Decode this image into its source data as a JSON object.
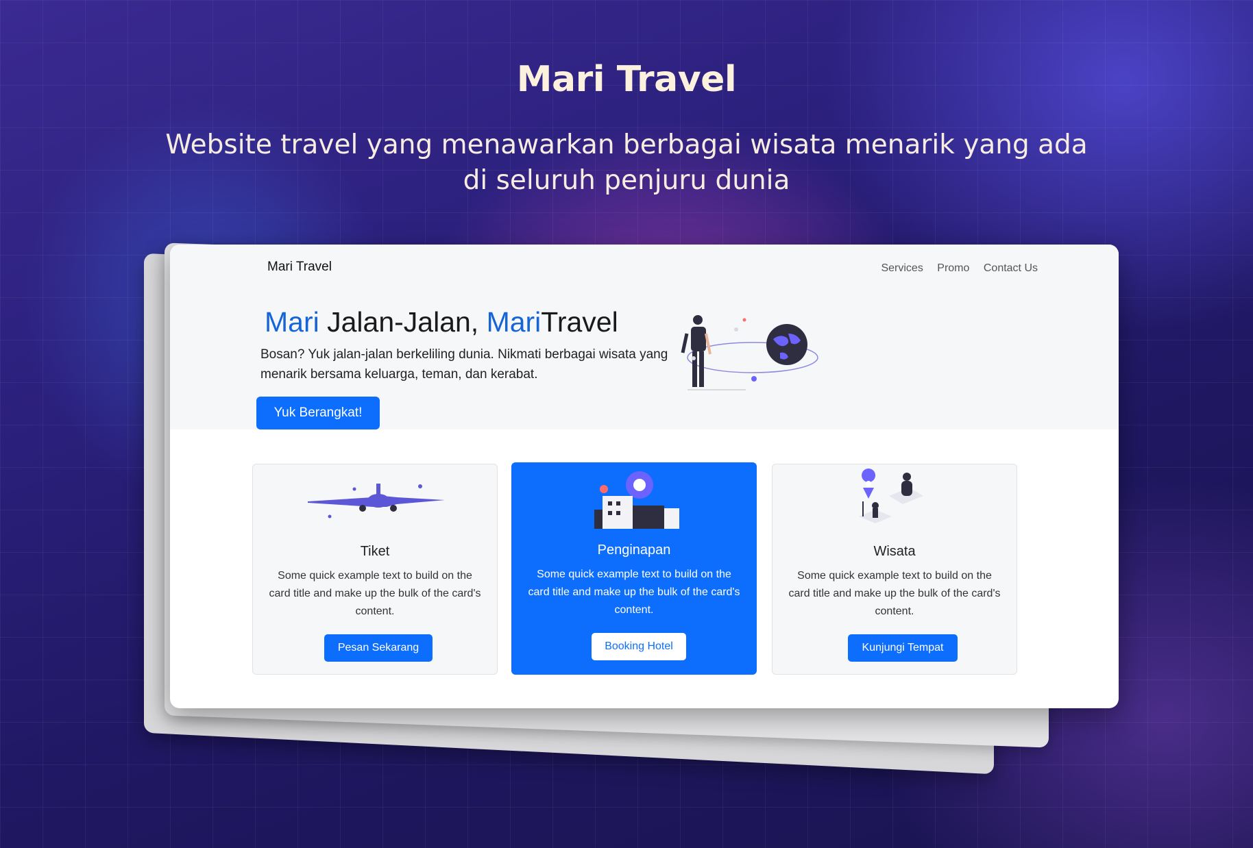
{
  "hero": {
    "title": "Mari Travel",
    "subtitle_line1": "Website travel yang menawarkan berbagai wisata menarik yang ada",
    "subtitle_line2": "di seluruh penjuru dunia"
  },
  "site": {
    "brand": "Mari Travel",
    "nav": [
      "Services",
      "Promo",
      "Contact Us"
    ],
    "headline": {
      "part1": "Mari",
      "part2": " Jalan-Jalan, ",
      "part3": "Mari",
      "part4": "Travel"
    },
    "lead": "Bosan? Yuk jalan-jalan berkeliling dunia. Nikmati berbagai wisata yang menarik bersama keluarga, teman, dan kerabat.",
    "cta": "Yuk Berangkat!",
    "cards": [
      {
        "title": "Tiket",
        "text": "Some quick example text to build on the card title and make up the bulk of the card's content.",
        "button": "Pesan Sekarang",
        "icon": "airplane-icon"
      },
      {
        "title": "Penginapan",
        "text": "Some quick example text to build on the card title and make up the bulk of the card's content.",
        "button": "Booking Hotel",
        "icon": "hotel-icon"
      },
      {
        "title": "Wisata",
        "text": "Some quick example text to build on the card title and make up the bulk of the card's content.",
        "button": "Kunjungi Tempat",
        "icon": "map-pin-icon"
      }
    ]
  },
  "colors": {
    "primary": "#0d6efd",
    "accent_purple": "#5b57d6",
    "headline_blue": "#1565d8"
  }
}
